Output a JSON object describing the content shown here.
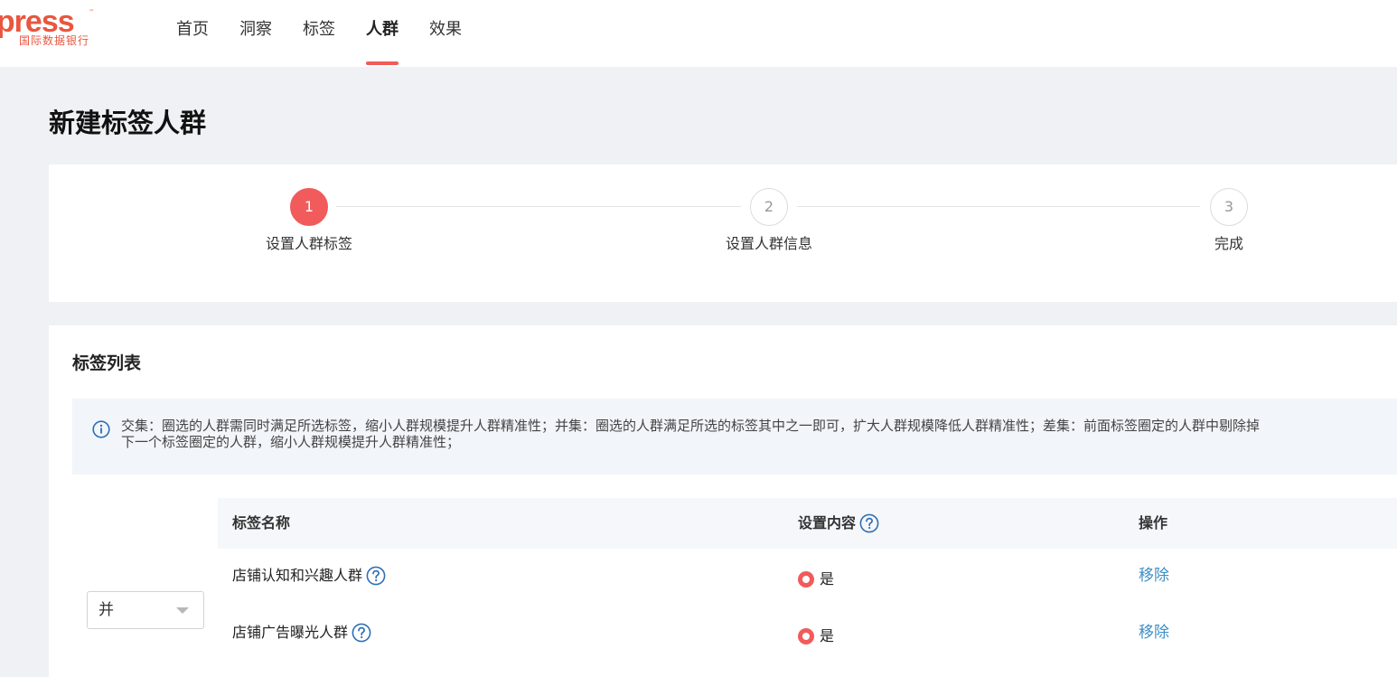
{
  "logo": {
    "main": "xpress",
    "tm": "™",
    "sub": "国际数据银行"
  },
  "nav": [
    {
      "label": "首页",
      "active": false
    },
    {
      "label": "洞察",
      "active": false
    },
    {
      "label": "标签",
      "active": false
    },
    {
      "label": "人群",
      "active": true
    },
    {
      "label": "效果",
      "active": false
    }
  ],
  "page": {
    "title": "新建标签人群"
  },
  "steps": [
    {
      "number": "1",
      "label": "设置人群标签",
      "active": true
    },
    {
      "number": "2",
      "label": "设置人群信息",
      "active": false
    },
    {
      "number": "3",
      "label": "完成",
      "active": false
    }
  ],
  "tag_list": {
    "title": "标签列表",
    "info_line1": "交集：圈选的人群需同时满足所选标签，缩小人群规模提升人群精准性；并集：圈选的人群满足所选的标签其中之一即可，扩大人群规模降低人群精准性；差集：前面标签圈定的人群中剔除掉",
    "info_line2": "下一个标签圈定的人群，缩小人群规模提升人群精准性；",
    "combinator": "并",
    "columns": {
      "name": "标签名称",
      "content": "设置内容",
      "action": "操作"
    },
    "rows": [
      {
        "name": "店铺认知和兴趣人群",
        "value": "是",
        "action": "移除"
      },
      {
        "name": "店铺广告曝光人群",
        "value": "是",
        "action": "移除"
      }
    ]
  },
  "colors": {
    "accent": "#f15b5b",
    "link": "#3d8fc7",
    "info_icon": "#2f6fb3"
  }
}
